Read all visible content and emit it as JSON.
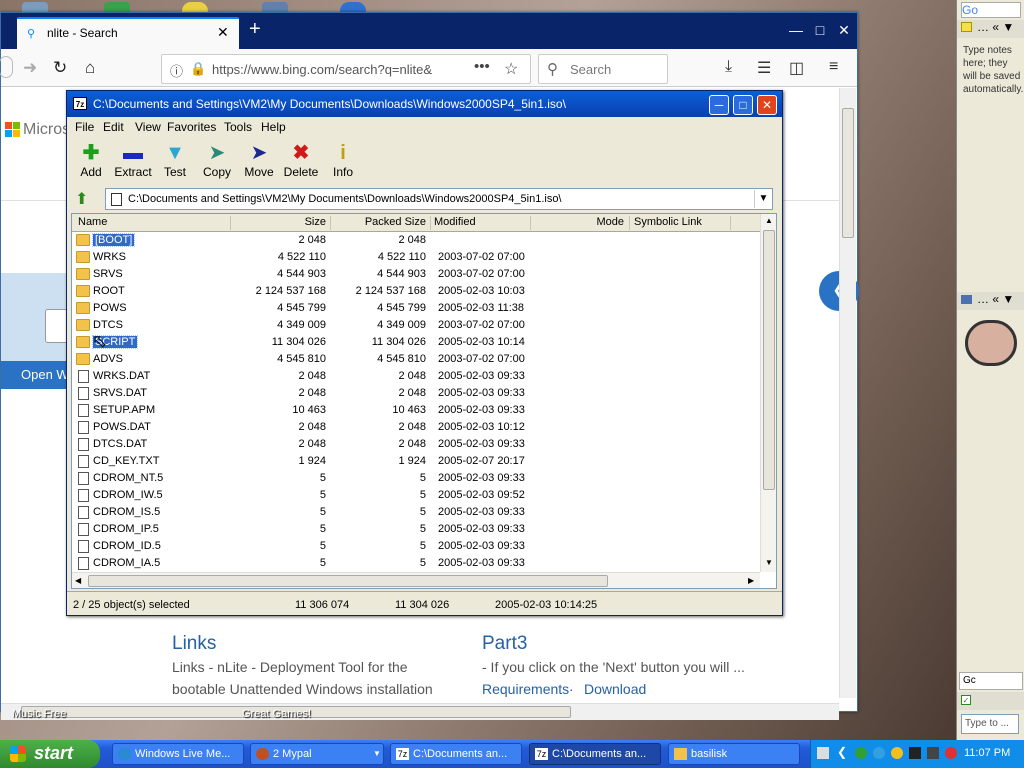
{
  "desktop": {
    "labels": [
      "Music Free",
      "Great Games!"
    ]
  },
  "browser": {
    "tab_title": "nlite - Search",
    "url": "https://www.bing.com/search?q=nlite&",
    "search_placeholder": "Search",
    "page": {
      "logo_text": "Micros",
      "open_button": "Open W",
      "links_title": "Links",
      "links_text_1": "Links - nLite - Deployment Tool for the",
      "links_text_2": "bootable Unattended Windows installation",
      "part3_title": "Part3",
      "part3_text": "- If you click on the 'Next' button you will ...",
      "part3_link1": "Requirements",
      "part3_sep": " · ",
      "part3_link2": "Download"
    }
  },
  "zip": {
    "title": "C:\\Documents and Settings\\VM2\\My Documents\\Downloads\\Windows2000SP4_5in1.iso\\",
    "menu": [
      "File",
      "Edit",
      "View",
      "Favorites",
      "Tools",
      "Help"
    ],
    "toolbar": [
      {
        "label": "Add",
        "icon": "plus-icon",
        "color": "#1aa01a"
      },
      {
        "label": "Extract",
        "icon": "minus-icon",
        "color": "#1a2ac0"
      },
      {
        "label": "Test",
        "icon": "check-icon",
        "color": "#2aa8d0"
      },
      {
        "label": "Copy",
        "icon": "copy-arrow-icon",
        "color": "#2a8a7a"
      },
      {
        "label": "Move",
        "icon": "move-arrow-icon",
        "color": "#1a2a90"
      },
      {
        "label": "Delete",
        "icon": "delete-x-icon",
        "color": "#d01a1a"
      },
      {
        "label": "Info",
        "icon": "info-icon",
        "color": "#c0a010"
      }
    ],
    "address": "C:\\Documents and Settings\\VM2\\My Documents\\Downloads\\Windows2000SP4_5in1.iso\\",
    "columns": [
      "Name",
      "Size",
      "Packed Size",
      "Modified",
      "Mode",
      "Symbolic Link"
    ],
    "rows": [
      {
        "name": "[BOOT]",
        "size": "2 048",
        "packed": "2 048",
        "modified": "",
        "type": "folder",
        "selected": true
      },
      {
        "name": "WRKS",
        "size": "4 522 110",
        "packed": "4 522 110",
        "modified": "2003-07-02 07:00",
        "type": "folder"
      },
      {
        "name": "SRVS",
        "size": "4 544 903",
        "packed": "4 544 903",
        "modified": "2003-07-02 07:00",
        "type": "folder"
      },
      {
        "name": "ROOT",
        "size": "2 124 537 168",
        "packed": "2 124 537 168",
        "modified": "2005-02-03 10:03",
        "type": "folder"
      },
      {
        "name": "POWS",
        "size": "4 545 799",
        "packed": "4 545 799",
        "modified": "2005-02-03 11:38",
        "type": "folder"
      },
      {
        "name": "DTCS",
        "size": "4 349 009",
        "packed": "4 349 009",
        "modified": "2003-07-02 07:00",
        "type": "folder"
      },
      {
        "name": "SCRIPT",
        "size": "11 304 026",
        "packed": "11 304 026",
        "modified": "2005-02-03 10:14",
        "type": "folder",
        "selected": true
      },
      {
        "name": "ADVS",
        "size": "4 545 810",
        "packed": "4 545 810",
        "modified": "2003-07-02 07:00",
        "type": "folder"
      },
      {
        "name": "WRKS.DAT",
        "size": "2 048",
        "packed": "2 048",
        "modified": "2005-02-03 09:33",
        "type": "file"
      },
      {
        "name": "SRVS.DAT",
        "size": "2 048",
        "packed": "2 048",
        "modified": "2005-02-03 09:33",
        "type": "file"
      },
      {
        "name": "SETUP.APM",
        "size": "10 463",
        "packed": "10 463",
        "modified": "2005-02-03 09:33",
        "type": "file"
      },
      {
        "name": "POWS.DAT",
        "size": "2 048",
        "packed": "2 048",
        "modified": "2005-02-03 10:12",
        "type": "file"
      },
      {
        "name": "DTCS.DAT",
        "size": "2 048",
        "packed": "2 048",
        "modified": "2005-02-03 09:33",
        "type": "file"
      },
      {
        "name": "CD_KEY.TXT",
        "size": "1 924",
        "packed": "1 924",
        "modified": "2005-02-07 20:17",
        "type": "file"
      },
      {
        "name": "CDROM_NT.5",
        "size": "5",
        "packed": "5",
        "modified": "2005-02-03 09:33",
        "type": "file"
      },
      {
        "name": "CDROM_IW.5",
        "size": "5",
        "packed": "5",
        "modified": "2005-02-03 09:52",
        "type": "file"
      },
      {
        "name": "CDROM_IS.5",
        "size": "5",
        "packed": "5",
        "modified": "2005-02-03 09:33",
        "type": "file"
      },
      {
        "name": "CDROM_IP.5",
        "size": "5",
        "packed": "5",
        "modified": "2005-02-03 09:33",
        "type": "file"
      },
      {
        "name": "CDROM_ID.5",
        "size": "5",
        "packed": "5",
        "modified": "2005-02-03 09:33",
        "type": "file"
      },
      {
        "name": "CDROM_IA.5",
        "size": "5",
        "packed": "5",
        "modified": "2005-02-03 09:33",
        "type": "file"
      }
    ],
    "status": {
      "selected": "2 / 25 object(s) selected",
      "size": "11 306 074",
      "packed": "11 304 026",
      "modified": "2005-02-03 10:14:25"
    }
  },
  "sidebar": {
    "notes": "Type notes here; they will be saved automatically.",
    "gadget_label": "Gc",
    "type_to": "Type to ..."
  },
  "taskbar": {
    "start": "start",
    "tasks": [
      {
        "label": "Windows Live Me...",
        "icon": "messenger-icon",
        "active": false
      },
      {
        "label": "2 Mypal",
        "icon": "browser-icon",
        "active": false
      },
      {
        "label": "C:\\Documents an...",
        "icon": "7zip-icon",
        "active": false
      },
      {
        "label": "C:\\Documents an...",
        "icon": "7zip-icon",
        "active": true
      },
      {
        "label": "basilisk",
        "icon": "folder-icon",
        "active": false
      }
    ],
    "clock": "11:07 PM"
  }
}
